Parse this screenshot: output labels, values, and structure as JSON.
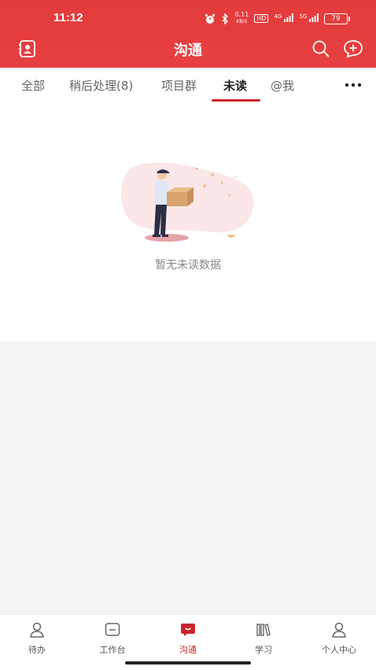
{
  "status_bar": {
    "time": "11:12",
    "net_speed_value": "0.11",
    "net_speed_unit": "KB/S",
    "hd_label": "HD",
    "signal1": "4G",
    "signal2": "5G",
    "battery": "79"
  },
  "header": {
    "title": "沟通"
  },
  "tabs": [
    {
      "label": "全部"
    },
    {
      "label": "稍后处理(8)"
    },
    {
      "label": "项目群"
    },
    {
      "label": "未读"
    },
    {
      "label": "@我"
    }
  ],
  "active_tab": "未读",
  "empty_state": {
    "text": "暂无未读数据"
  },
  "bottom_nav": [
    {
      "label": "待办",
      "icon": "person-icon"
    },
    {
      "label": "工作台",
      "icon": "workbench-icon"
    },
    {
      "label": "沟通",
      "icon": "chat-icon"
    },
    {
      "label": "学习",
      "icon": "books-icon"
    },
    {
      "label": "个人中心",
      "icon": "user-icon"
    }
  ],
  "colors": {
    "header_bg": "#e33b3b",
    "accent": "#c9252c"
  }
}
